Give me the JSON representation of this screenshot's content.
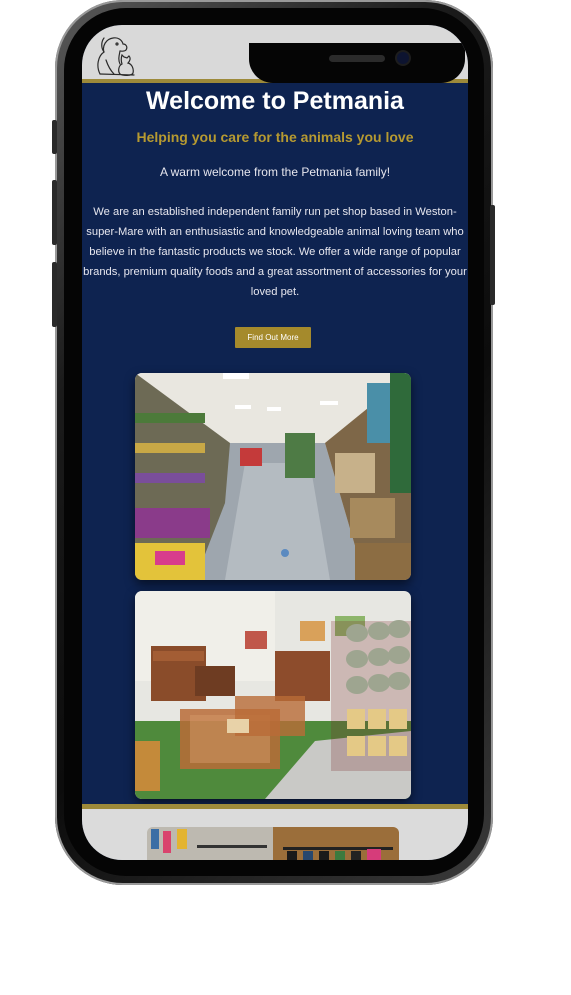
{
  "device": {
    "type": "smartphone mockup"
  },
  "site": {
    "logo_icon": "dog-and-cat-logo-icon",
    "menu_icon": "hamburger-menu-icon",
    "colors": {
      "navy": "#0e2350",
      "gold": "#b69a31",
      "header_gray": "#d9d9d9",
      "button_gold": "#a58a2c"
    }
  },
  "hero": {
    "title": "Welcome to Petmania",
    "subtitle": "Helping you care for the animals you love",
    "welcome": "A warm welcome from the Petmania family!",
    "intro": "We are an established independent family run pet shop based in Weston-super-Mare with an enthusiastic and knowledgeable animal loving team who believe in the fantastic products we stock. We offer a wide range of popular brands, premium quality foods and a great assortment of accessories for your loved pet.",
    "cta_label": "Find Out More"
  }
}
